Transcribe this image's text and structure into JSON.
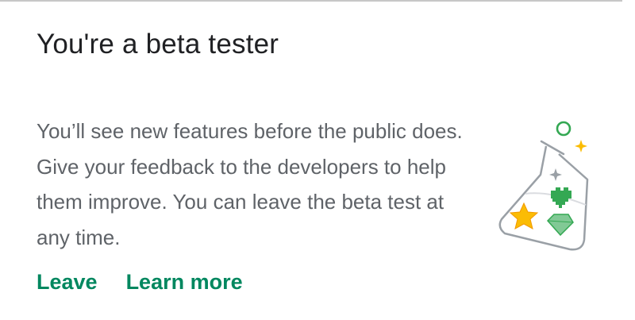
{
  "beta_card": {
    "title": "You're a beta tester",
    "description": "You’ll see new features before the public does. Give your feedback to the developers to help them improve. You can leave the beta test at any time.",
    "actions": {
      "leave_label": "Leave",
      "learn_more_label": "Learn more"
    },
    "illustration": {
      "icon": "beta-flask-icon",
      "colors": {
        "accent_green": "#34a853",
        "gem_green": "#81c995",
        "star_yellow": "#fbbc04",
        "flask_outline": "#9aa0a6"
      }
    }
  },
  "colors": {
    "title": "#202124",
    "body_text": "#5f6368",
    "action_text": "#01875f",
    "divider": "#c7c7c7"
  }
}
